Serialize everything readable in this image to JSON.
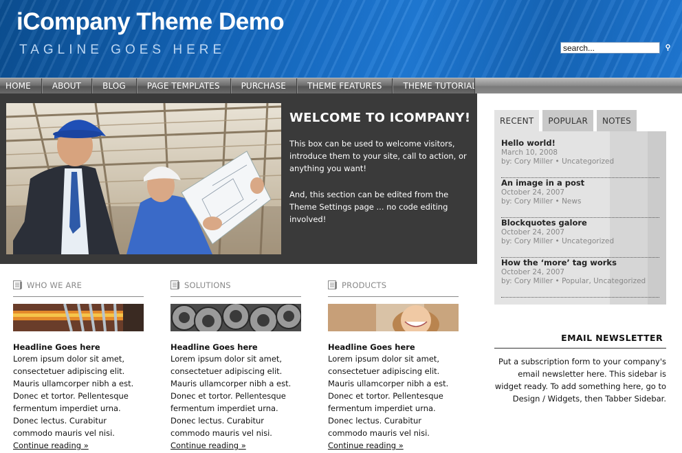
{
  "header": {
    "title": "iCompany Theme Demo",
    "tagline": "TAGLINE GOES HERE",
    "search_value": "search..."
  },
  "nav": {
    "items": [
      "HOME",
      "ABOUT",
      "BLOG",
      "PAGE TEMPLATES",
      "PURCHASE",
      "THEME FEATURES",
      "THEME TUTORIALS"
    ]
  },
  "feature": {
    "title": "WELCOME TO ICOMPANY!",
    "paragraph1": "This box can be used to welcome visitors, introduce them to your site, call to action, or anything you want!",
    "paragraph2": "And, this section can be edited from the Theme Settings page ... no code editing involved!"
  },
  "columns": [
    {
      "label": "WHO WE ARE",
      "headline": "Headline Goes here",
      "body": "Lorem ipsum dolor sit amet, consectetuer adipiscing elit. Mauris ullamcorper nibh a est. Donec et tortor. Pellentesque fermentum imperdiet urna. Donec lectus. Curabitur commodo mauris vel nisi.",
      "link": "Continue reading »"
    },
    {
      "label": "SOLUTIONS",
      "headline": "Headline Goes here",
      "body": "Lorem ipsum dolor sit amet, consectetuer adipiscing elit. Mauris ullamcorper nibh a est. Donec et tortor. Pellentesque fermentum imperdiet urna. Donec lectus. Curabitur commodo mauris vel nisi.",
      "link": "Continue reading »"
    },
    {
      "label": "PRODUCTS",
      "headline": "Headline Goes here",
      "body": "Lorem ipsum dolor sit amet, consectetuer adipiscing elit. Mauris ullamcorper nibh a est. Donec et tortor. Pellentesque fermentum imperdiet urna. Donec lectus. Curabitur commodo mauris vel nisi.",
      "link": "Continue reading »"
    }
  ],
  "sidebar": {
    "tabs": [
      "RECENT",
      "POPULAR",
      "NOTES"
    ],
    "active_tab": "RECENT",
    "posts": [
      {
        "title": "Hello world!",
        "date": "March 10, 2008",
        "meta": "by: Cory Miller • Uncategorized"
      },
      {
        "title": "An image in a post",
        "date": "October 24, 2007",
        "meta": "by: Cory Miller • News"
      },
      {
        "title": "Blockquotes galore",
        "date": "October 24, 2007",
        "meta": "by: Cory Miller • Uncategorized"
      },
      {
        "title": "How the ‘more’ tag works",
        "date": "October 24, 2007",
        "meta": "by: Cory Miller • Popular, Uncategorized"
      }
    ],
    "newsletter": {
      "title": "EMAIL NEWSLETTER",
      "text": "Put a subscription form to your company's email newsletter here. This sidebar is widget ready. To add something here, go to Design / Widgets, then Tabber Sidebar."
    }
  },
  "colors": {
    "header_blue": "#1467bd",
    "nav_gray": "#6f6f6f",
    "feature_bg": "#3a3a3a",
    "sidebar_bg": "#e3e3e3"
  }
}
